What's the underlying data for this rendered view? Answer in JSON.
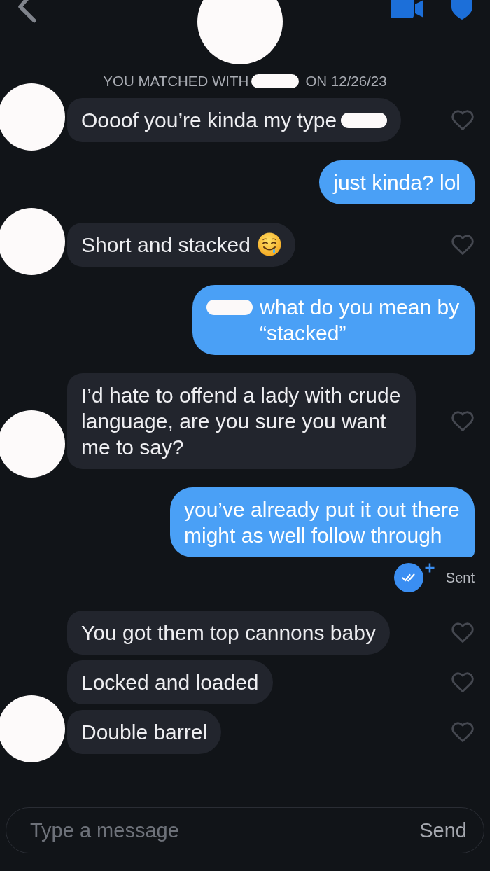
{
  "match_notice": {
    "parts": [
      {
        "kind": "text",
        "text": "YOU MATCHED WITH"
      },
      {
        "kind": "redaction"
      },
      {
        "kind": "text",
        "text": "ON 12/26/23"
      }
    ]
  },
  "conversation": [
    {
      "kind": "incoming",
      "messages": [
        {
          "parts": [
            {
              "kind": "text",
              "text": "Oooof you’re kinda my type"
            },
            {
              "kind": "redaction"
            }
          ],
          "liked": false
        }
      ]
    },
    {
      "kind": "outgoing",
      "messages": [
        {
          "parts": [
            {
              "kind": "text",
              "text": "just kinda? lol"
            }
          ]
        }
      ]
    },
    {
      "kind": "incoming",
      "messages": [
        {
          "parts": [
            {
              "kind": "text",
              "text": "Short and stacked"
            },
            {
              "kind": "emoji"
            }
          ],
          "liked": false
        }
      ]
    },
    {
      "kind": "outgoing",
      "messages": [
        {
          "parts": [
            {
              "kind": "redaction"
            },
            {
              "kind": "text",
              "text": "what do you mean by “stacked”"
            }
          ]
        }
      ]
    },
    {
      "kind": "incoming",
      "messages": [
        {
          "parts": [
            {
              "kind": "text",
              "text": "I’d hate to offend a lady with crude language, are you sure you want me to say?"
            }
          ],
          "liked": false
        }
      ]
    },
    {
      "kind": "outgoing",
      "messages": [
        {
          "parts": [
            {
              "kind": "text",
              "text": "you’ve already put it out there might as well follow through"
            }
          ]
        }
      ],
      "status": "Sent"
    },
    {
      "kind": "incoming",
      "messages": [
        {
          "parts": [
            {
              "kind": "text",
              "text": "You got them top cannons baby"
            }
          ],
          "liked": false
        },
        {
          "parts": [
            {
              "kind": "text",
              "text": "Locked and loaded"
            }
          ],
          "liked": false
        },
        {
          "parts": [
            {
              "kind": "text",
              "text": "Double barrel"
            }
          ],
          "liked": false
        }
      ]
    }
  ],
  "composer": {
    "placeholder": "Type a message",
    "send_label": "Send"
  }
}
